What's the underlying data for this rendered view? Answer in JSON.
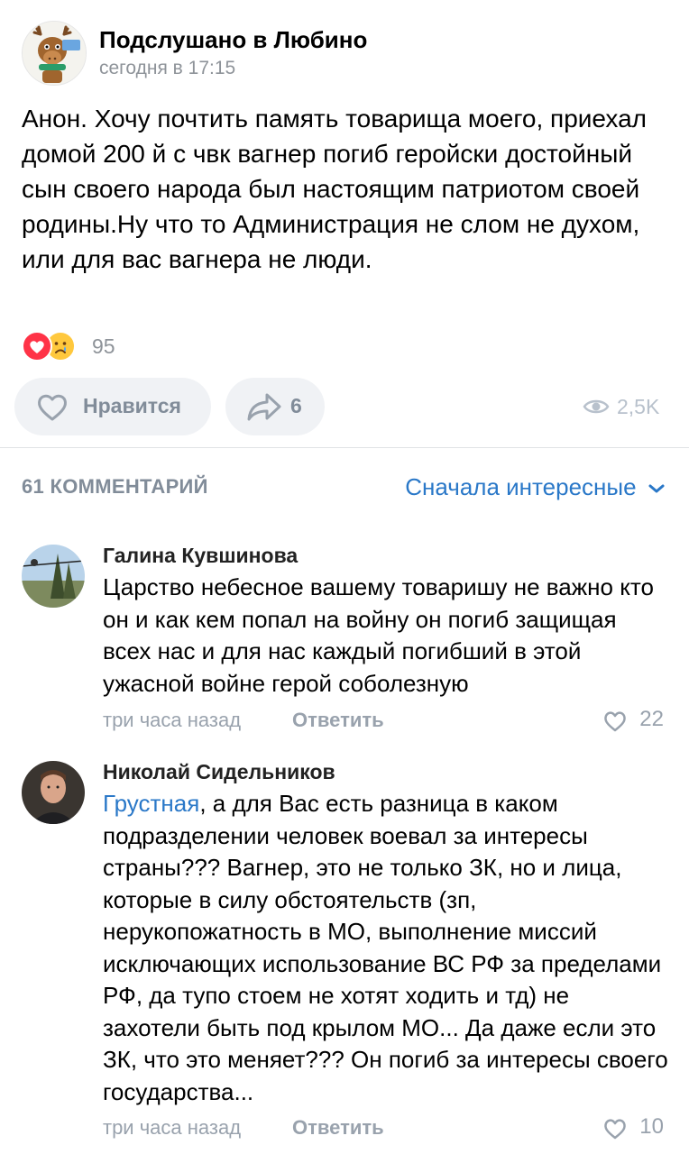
{
  "post": {
    "group_name": "Подслушано в Любино",
    "time": "сегодня в 17:15",
    "text": "Анон. Хочу почтить память товарища моего, приехал домой 200 й с чвк вагнер погиб геройски достойный сын своего народа был настоящим патриотом своей родины.Ну что то Администрация не слом не духом, или для вас вагнера не люди.",
    "reactions_count": "95",
    "like_label": "Нравится",
    "share_count": "6",
    "views": "2,5K"
  },
  "comments_header": {
    "count_label": "61 КОММЕНТАРИЙ",
    "sort_label": "Сначала интересные"
  },
  "comments": [
    {
      "author": "Галина Кувшинова",
      "text": "Царство небесное вашему товаришу не важно кто он и как кем попал на войну он погиб защищая всех нас и для нас каждый погибший в этой ужасной войне герой соболезную",
      "time": "три часа назад",
      "reply_label": "Ответить",
      "likes": "22"
    },
    {
      "author": "Николай Сидельников",
      "mention": "Грустная",
      "text": ", а для Вас есть разница в каком подразделении человек воевал за интересы страны??? Вагнер, это не только ЗК, но и лица, которые в силу обстоятельств (зп, нерукопожатность в МО, выполнение миссий исключающих использование ВС РФ за пределами РФ, да тупо стоем не хотят ходить и тд) не захотели быть под крылом МО... Да даже если это ЗК, что это меняет??? Он погиб за интересы своего государства...",
      "time": "три часа назад",
      "reply_label": "Ответить",
      "likes": "10"
    }
  ],
  "icons": {
    "heart": "heart-outline-icon",
    "share": "share-arrow-icon",
    "views": "eye-icon",
    "chevron": "chevron-down-icon",
    "reaction_1": "heart-reaction-icon",
    "reaction_2": "crying-face-reaction-icon"
  },
  "colors": {
    "accent": "#2a78c8",
    "secondary_text": "#818c99",
    "button_bg": "#f0f2f5",
    "reaction_heart": "#ff3347",
    "reaction_emoji": "#ffc83d"
  }
}
